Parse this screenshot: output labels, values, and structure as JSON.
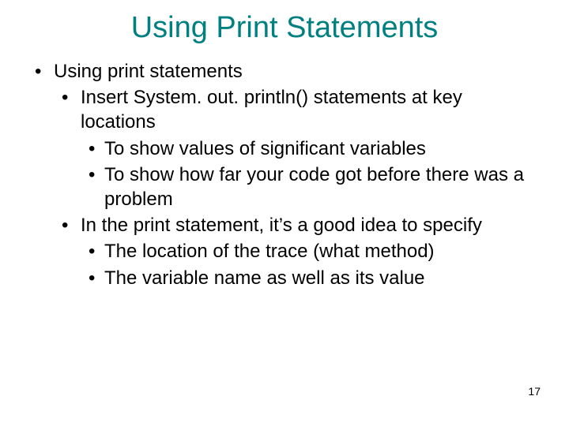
{
  "title": "Using Print Statements",
  "bullets": {
    "l1": "Using print statements",
    "l2a_pre": "Insert ",
    "l2a_code": "System. out. println()",
    "l2a_post": " statements at key locations",
    "l3a": "To show values of significant variables",
    "l3b": "To show how far your code got before there was a problem",
    "l2b": "In the print statement, it’s a good idea to specify",
    "l3c": "The location of the trace (what method)",
    "l3d": "The variable name as well as its value"
  },
  "page_number": "17"
}
